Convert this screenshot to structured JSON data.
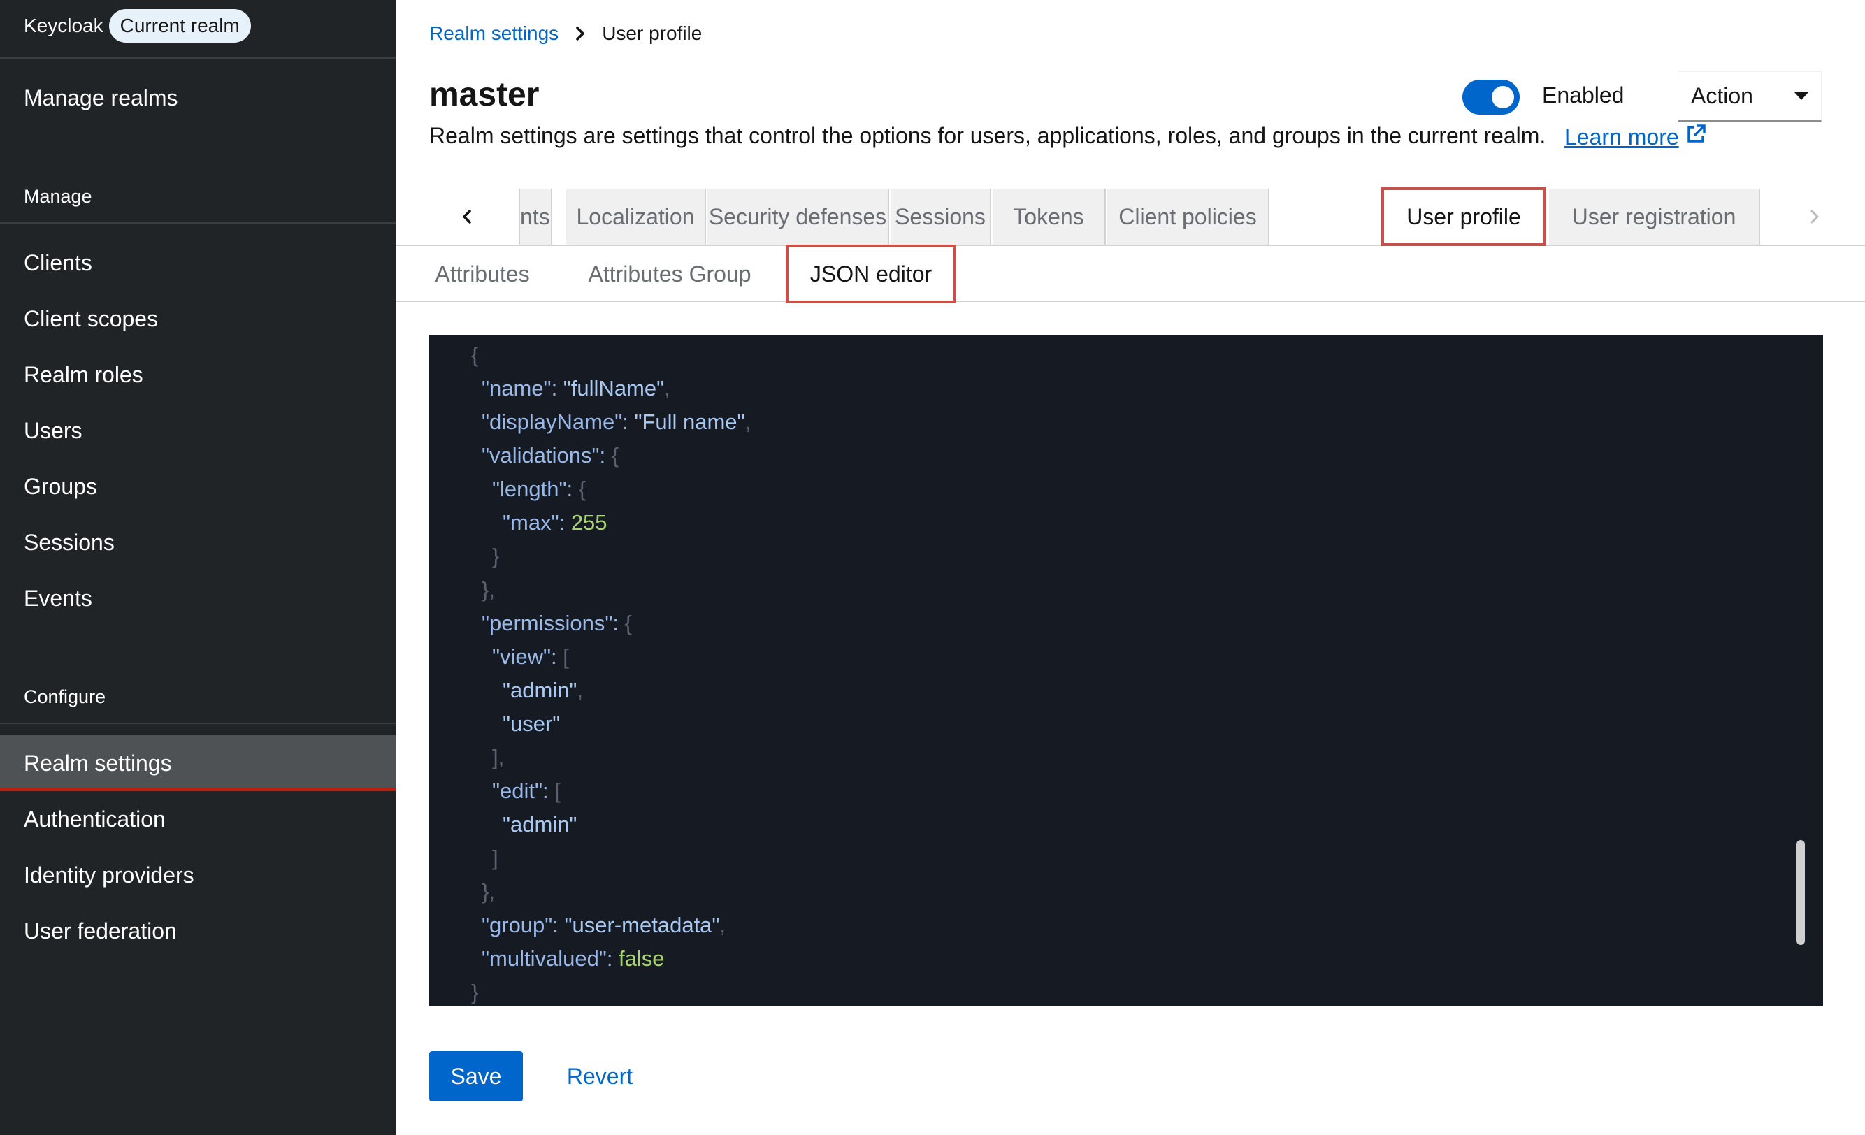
{
  "sidebar": {
    "brand": "Keycloak",
    "realm_badge": "Current realm",
    "manage_realms": "Manage realms",
    "section_manage": "Manage",
    "manage_items": [
      "Clients",
      "Client scopes",
      "Realm roles",
      "Users",
      "Groups",
      "Sessions",
      "Events"
    ],
    "section_configure": "Configure",
    "configure_items": [
      "Realm settings",
      "Authentication",
      "Identity providers",
      "User federation"
    ],
    "active_item": "Realm settings"
  },
  "breadcrumb": {
    "parent": "Realm settings",
    "current": "User profile"
  },
  "header": {
    "title": "master",
    "description": "Realm settings are settings that control the options for users, applications, roles, and groups in the current realm.",
    "learn_more": "Learn more",
    "toggle_label": "Enabled",
    "toggle_on": true,
    "action_label": "Action"
  },
  "tabs": {
    "items": [
      "nts",
      "Localization",
      "Security defenses",
      "Sessions",
      "Tokens",
      "Client policies",
      "User profile",
      "User registration"
    ],
    "active": "User profile"
  },
  "subtabs": {
    "items": [
      "Attributes",
      "Attributes Group",
      "JSON editor"
    ],
    "active": "JSON editor"
  },
  "editor": {
    "lines": [
      {
        "indent": 0,
        "parts": [
          [
            "p",
            "{"
          ]
        ]
      },
      {
        "indent": 1,
        "parts": [
          [
            "k",
            "\"name\""
          ],
          [
            "c",
            ": "
          ],
          [
            "s",
            "\"fullName\""
          ],
          [
            "p",
            ","
          ]
        ]
      },
      {
        "indent": 1,
        "parts": [
          [
            "k",
            "\"displayName\""
          ],
          [
            "c",
            ": "
          ],
          [
            "s",
            "\"Full name\""
          ],
          [
            "p",
            ","
          ]
        ]
      },
      {
        "indent": 1,
        "parts": [
          [
            "k",
            "\"validations\""
          ],
          [
            "c",
            ": "
          ],
          [
            "p",
            "{"
          ]
        ]
      },
      {
        "indent": 2,
        "parts": [
          [
            "k",
            "\"length\""
          ],
          [
            "c",
            ": "
          ],
          [
            "p",
            "{"
          ]
        ]
      },
      {
        "indent": 3,
        "parts": [
          [
            "k",
            "\"max\""
          ],
          [
            "c",
            ": "
          ],
          [
            "n",
            "255"
          ]
        ]
      },
      {
        "indent": 2,
        "parts": [
          [
            "p",
            "}"
          ]
        ]
      },
      {
        "indent": 1,
        "parts": [
          [
            "p",
            "},"
          ]
        ]
      },
      {
        "indent": 1,
        "parts": [
          [
            "k",
            "\"permissions\""
          ],
          [
            "c",
            ": "
          ],
          [
            "p",
            "{"
          ]
        ]
      },
      {
        "indent": 2,
        "parts": [
          [
            "k",
            "\"view\""
          ],
          [
            "c",
            ": "
          ],
          [
            "p",
            "["
          ]
        ]
      },
      {
        "indent": 3,
        "parts": [
          [
            "s",
            "\"admin\""
          ],
          [
            "p",
            ","
          ]
        ]
      },
      {
        "indent": 3,
        "parts": [
          [
            "s",
            "\"user\""
          ]
        ]
      },
      {
        "indent": 2,
        "parts": [
          [
            "p",
            "],"
          ]
        ]
      },
      {
        "indent": 2,
        "parts": [
          [
            "k",
            "\"edit\""
          ],
          [
            "c",
            ": "
          ],
          [
            "p",
            "["
          ]
        ]
      },
      {
        "indent": 3,
        "parts": [
          [
            "s",
            "\"admin\""
          ]
        ]
      },
      {
        "indent": 2,
        "parts": [
          [
            "p",
            "]"
          ]
        ]
      },
      {
        "indent": 1,
        "parts": [
          [
            "p",
            "},"
          ]
        ]
      },
      {
        "indent": 1,
        "parts": [
          [
            "k",
            "\"group\""
          ],
          [
            "c",
            ": "
          ],
          [
            "s",
            "\"user-metadata\""
          ],
          [
            "p",
            ","
          ]
        ]
      },
      {
        "indent": 1,
        "parts": [
          [
            "k",
            "\"multivalued\""
          ],
          [
            "c",
            ": "
          ],
          [
            "n",
            "false"
          ]
        ]
      },
      {
        "indent": 0,
        "parts": [
          [
            "p",
            "}"
          ]
        ]
      }
    ]
  },
  "footer": {
    "save": "Save",
    "revert": "Revert"
  },
  "colors": {
    "sidebar_bg": "#212427",
    "accent": "#0066cc",
    "highlight_border": "#c9504a",
    "editor_bg": "#151a23"
  }
}
